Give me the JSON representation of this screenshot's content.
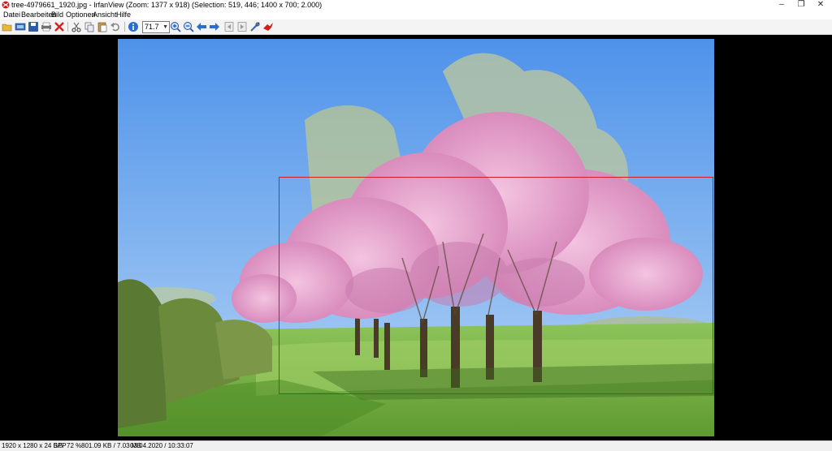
{
  "window": {
    "title": "tree-4979661_1920.jpg - IrfanView (Zoom: 1377 x 918) (Selection: 519, 446; 1400 x 700; 2.000)",
    "minimize": "–",
    "restore": "❐",
    "close": "✕"
  },
  "menu": [
    "Datei",
    "Bearbeiten",
    "Bild",
    "Optionen",
    "Ansicht",
    "Hilfe"
  ],
  "toolbar": {
    "zoom_value": "71.7",
    "icons": [
      "open-folder-icon",
      "slideshow-icon",
      "save-icon",
      "print-icon",
      "delete-icon",
      "cut-icon",
      "copy-icon",
      "paste-icon",
      "undo-icon",
      "info-icon",
      "zoom-in-icon",
      "zoom-out-icon",
      "previous-icon",
      "next-icon",
      "page-first-icon",
      "page-last-icon",
      "settings-icon",
      "irfanview-logo-icon"
    ]
  },
  "image": {
    "description_colors": {
      "sky": "#5a9bea",
      "grass": "#7fb84a",
      "blossom": "#e6a3cc"
    }
  },
  "selection_color": "#d02020",
  "status": {
    "dimensions": "1920 x 1280 x 24 BPP",
    "index": "5/5",
    "zoom": "72 %",
    "size": "801.09 KB / 7.03 MB",
    "datetime": "03.04.2020 / 10:33:07"
  }
}
